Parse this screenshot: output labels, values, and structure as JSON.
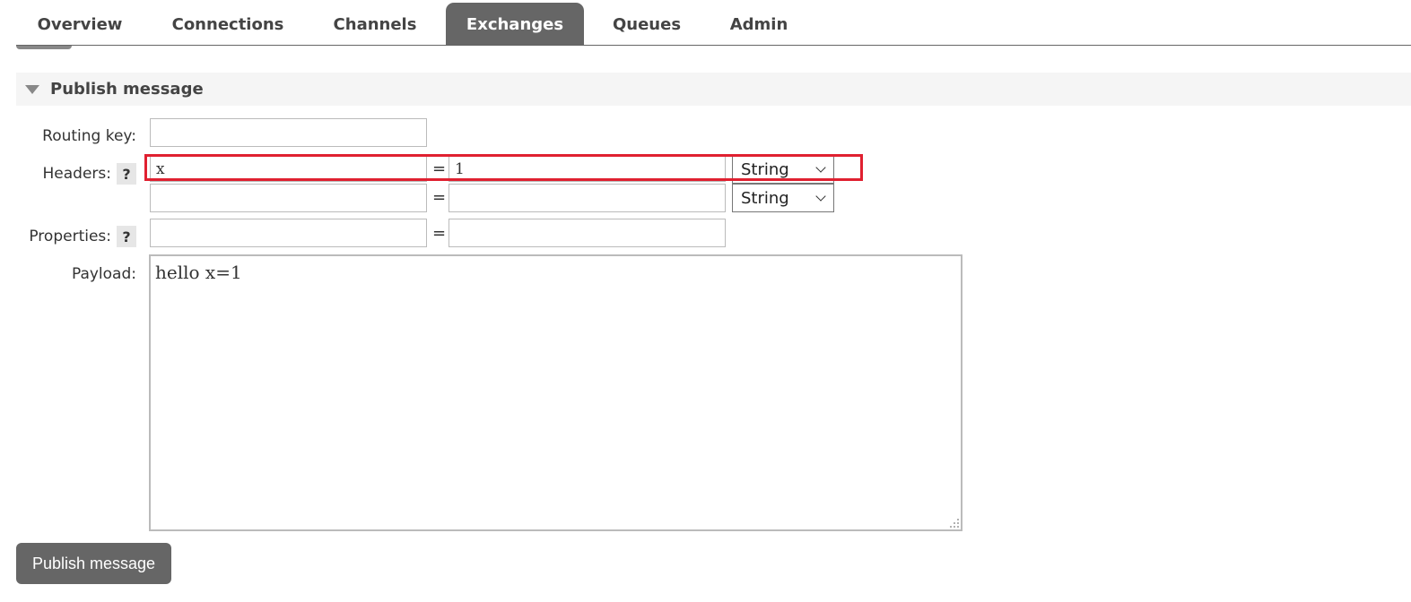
{
  "nav": {
    "tabs": [
      {
        "label": "Overview"
      },
      {
        "label": "Connections"
      },
      {
        "label": "Channels"
      },
      {
        "label": "Exchanges",
        "active": true
      },
      {
        "label": "Queues"
      },
      {
        "label": "Admin"
      }
    ]
  },
  "section": {
    "title": "Publish message"
  },
  "form": {
    "routing_key_label": "Routing key:",
    "routing_key_value": "",
    "headers_label": "Headers:",
    "help_label": "?",
    "equals": "=",
    "headers": [
      {
        "key": "x",
        "value": "1",
        "type": "String"
      },
      {
        "key": "",
        "value": "",
        "type": "String"
      }
    ],
    "properties_label": "Properties:",
    "properties": [
      {
        "key": "",
        "value": ""
      }
    ],
    "payload_label": "Payload:",
    "payload_value": "hello x=1",
    "publish_button": "Publish message"
  },
  "colors": {
    "tab_active_bg": "#666666",
    "highlight_border": "#e02030",
    "section_bg": "#f5f5f5"
  }
}
